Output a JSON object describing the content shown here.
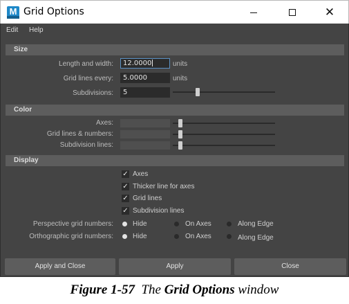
{
  "window": {
    "title": "Grid Options",
    "icon_letter": "M",
    "icon": "maya-app-icon",
    "controls": [
      "minimize-icon",
      "maximize-icon",
      "close-icon"
    ]
  },
  "menu": [
    "Edit",
    "Help"
  ],
  "size_section": {
    "header": "Size",
    "length_label": "Length and width:",
    "length_value": "12.0000",
    "length_units": "units",
    "gridlines_label": "Grid lines every:",
    "gridlines_value": "5.0000",
    "gridlines_units": "units",
    "subdivisions_label": "Subdivisions:",
    "subdivisions_value": "5",
    "subdivisions_slider_fraction": 0.23
  },
  "color_section": {
    "header": "Color",
    "axes_label": "Axes:",
    "gridlines_label": "Grid lines & numbers:",
    "subdivision_label": "Subdivision lines:"
  },
  "display_section": {
    "header": "Display",
    "checkboxes": [
      {
        "label": "Axes",
        "checked": true
      },
      {
        "label": "Thicker line for axes",
        "checked": true
      },
      {
        "label": "Grid lines",
        "checked": true
      },
      {
        "label": "Subdivision lines",
        "checked": true
      }
    ],
    "perspective_label": "Perspective grid numbers:",
    "orthographic_label": "Orthographic grid numbers:",
    "radio_options": [
      "Hide",
      "On Axes",
      "Along Edge"
    ],
    "perspective_selected": "Hide",
    "orthographic_selected": "Hide"
  },
  "buttons": {
    "apply_close": "Apply and Close",
    "apply": "Apply",
    "close": "Close"
  },
  "caption": {
    "figure": "Figure 1-57",
    "the": "The",
    "name": "Grid Options",
    "suffix": "window"
  },
  "colors": {
    "panel_bg": "#444444",
    "section_bg": "#5d5d5d",
    "field_bg": "#2b2b2b",
    "focus_border": "#5b90c4",
    "app_icon": "#1e88c8"
  }
}
